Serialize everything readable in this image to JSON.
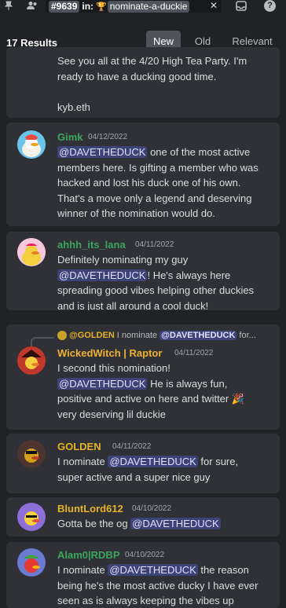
{
  "topbar": {
    "channel_chip": "#9639",
    "in_label": "in:",
    "trophy_glyph": "🏆",
    "channel_name": "nominate-a-duckie",
    "close_glyph": "✕",
    "help_glyph": "?"
  },
  "results": {
    "count_label": "17 Results",
    "tabs": [
      "New",
      "Old",
      "Relevant"
    ]
  },
  "messages": [
    {
      "lines": [
        "See you all at the 4/20 High Tea Party. I'm",
        "ready to have a ducking good time.",
        "",
        "kyb.eth"
      ]
    },
    {
      "username": "Gimk",
      "timestamp": "04/12/2022",
      "mention": "@DAVETHEDUCK",
      "text_after": " one of the most active",
      "lines": [
        "members here. Is gifting a member who was",
        "hacked and lost his duck one of his own.",
        "That's a move only a legend and deserving",
        "winner of the nomination would do."
      ]
    },
    {
      "username": "ahhh_its_lana",
      "timestamp": "04/11/2022",
      "line1": "Definitely nominating my guy",
      "mention": "@DAVETHEDUCK",
      "text_after": "! He's always here",
      "lines": [
        "spreading good vibes helping other duckies",
        "and is just all around a cool duck!"
      ]
    },
    {
      "reply_name": "@GOLDEN",
      "reply_text": "I nominate",
      "reply_mention": "@DAVETHEDUCK",
      "reply_tail": "for...",
      "username": "WickedWitch | Raptor",
      "timestamp": "04/11/2022",
      "line1": "I second this nomination!",
      "mention": "@DAVETHEDUCK",
      "text_after": " He is always fun,",
      "line3": "positive and active on here and twitter 🎉",
      "line4": "very deserving lil duckie"
    },
    {
      "username": "GOLDEN",
      "timestamp": "04/11/2022",
      "text_before": "I nominate ",
      "mention": "@DAVETHEDUCK",
      "text_after": " for sure,",
      "line2": "super active and a super nice guy"
    },
    {
      "username": "BluntLord612",
      "timestamp": "04/10/2022",
      "text_before": "Gotta be the og ",
      "mention": "@DAVETHEDUCK"
    },
    {
      "username": "Alam0|RDBP",
      "timestamp": "04/10/2022",
      "text_before": "I nominate ",
      "mention": "@DAVETHEDUCK",
      "text_after": " the reason",
      "lines": [
        "being he's the most active ducky I have ever",
        "seen as is always keeping the vibes up"
      ]
    }
  ],
  "colors": {
    "gimk": "#3ba55d",
    "lana": "#3ba55d",
    "wicked": "#f0b232",
    "golden": "#e6b325",
    "blunt": "#e6b325",
    "alam": "#3ba55d",
    "mention_bg": "#5865f2"
  }
}
